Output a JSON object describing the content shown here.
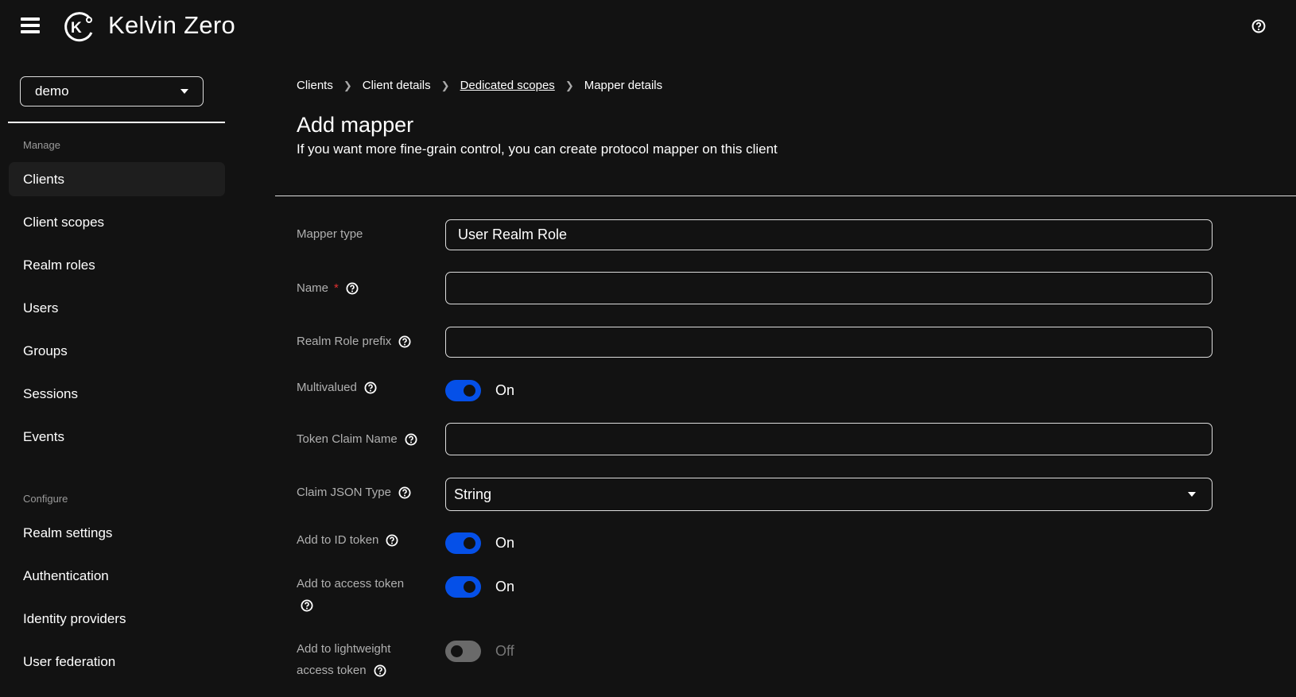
{
  "header": {
    "brand": "Kelvin Zero"
  },
  "realm_selector": {
    "value": "demo"
  },
  "sidebar": {
    "sections": [
      {
        "label": "Manage",
        "items": [
          {
            "label": "Clients",
            "active": true
          },
          {
            "label": "Client scopes"
          },
          {
            "label": "Realm roles"
          },
          {
            "label": "Users"
          },
          {
            "label": "Groups"
          },
          {
            "label": "Sessions"
          },
          {
            "label": "Events"
          }
        ]
      },
      {
        "label": "Configure",
        "items": [
          {
            "label": "Realm settings"
          },
          {
            "label": "Authentication"
          },
          {
            "label": "Identity providers"
          },
          {
            "label": "User federation"
          }
        ]
      }
    ]
  },
  "breadcrumb": [
    "Clients",
    "Client details",
    "Dedicated scopes",
    "Mapper details"
  ],
  "page": {
    "title": "Add mapper",
    "subtitle": "If you want more fine-grain control, you can create protocol mapper on this client"
  },
  "form": {
    "mapper_type": {
      "label": "Mapper type",
      "value": "User Realm Role"
    },
    "name": {
      "label": "Name",
      "required": "*",
      "value": ""
    },
    "realm_role_prefix": {
      "label": "Realm Role prefix",
      "value": ""
    },
    "multivalued": {
      "label": "Multivalued",
      "state": "On"
    },
    "token_claim_name": {
      "label": "Token Claim Name",
      "value": ""
    },
    "claim_json_type": {
      "label": "Claim JSON Type",
      "value": "String"
    },
    "add_to_id_token": {
      "label": "Add to ID token",
      "state": "On"
    },
    "add_to_access_token": {
      "label": "Add to access token",
      "state": "On"
    },
    "add_to_lightweight": {
      "label_line1": "Add to lightweight",
      "label_line2": "access token",
      "state": "Off"
    }
  },
  "colors": {
    "accent": "#0550e8",
    "background": "#121212"
  }
}
